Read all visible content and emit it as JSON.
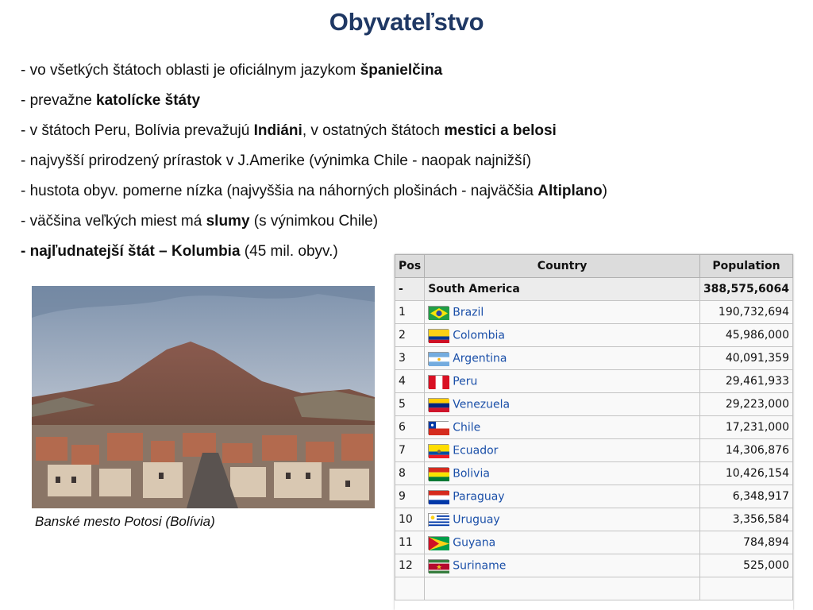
{
  "slide": {
    "title": "Obyvateľstvo",
    "bullets": [
      {
        "parts": [
          {
            "t": "-  vo všetkých štátoch oblasti je oficiálnym jazykom "
          },
          {
            "t": "španielčina",
            "b": true
          }
        ]
      },
      {
        "parts": [
          {
            "t": "-  prevažne "
          },
          {
            "t": "katolícke štáty",
            "b": true
          }
        ]
      },
      {
        "parts": [
          {
            "t": "-  v štátoch Peru, Bolívia prevažujú "
          },
          {
            "t": "Indiáni",
            "b": true
          },
          {
            "t": ", v ostatných štátoch "
          },
          {
            "t": "mestici a belosi",
            "b": true
          }
        ]
      },
      {
        "parts": [
          {
            "t": "-  najvyšší prirodzený prírastok v J.Amerike (výnimka Chile - naopak najnižší)"
          }
        ]
      },
      {
        "parts": [
          {
            "t": "-  hustota obyv. pomerne nízka (najvyššia  na náhorných plošinách - najväčšia "
          },
          {
            "t": "Altiplano",
            "b": true
          },
          {
            "t": ")"
          }
        ]
      },
      {
        "parts": [
          {
            "t": "-  väčšina veľkých miest má "
          },
          {
            "t": "slumy",
            "b": true
          },
          {
            "t": "  (s výnimkou Chile)"
          }
        ]
      },
      {
        "parts": [
          {
            "t": "-  najľudnatejší štát – Kolumbia",
            "b": true
          },
          {
            "t": " (45 mil. obyv.)"
          }
        ]
      }
    ],
    "caption": "Banské mesto Potosi (Bolívia)"
  },
  "table": {
    "headers": {
      "pos": "Pos",
      "country": "Country",
      "population": "Population"
    },
    "total": {
      "pos": "-",
      "country": "South America",
      "population": "388,575,6064"
    },
    "rows": [
      {
        "pos": "1",
        "country": "Brazil",
        "population": "190,732,694",
        "flag": "brazil"
      },
      {
        "pos": "2",
        "country": "Colombia",
        "population": "45,986,000",
        "flag": "colombia"
      },
      {
        "pos": "3",
        "country": "Argentina",
        "population": "40,091,359",
        "flag": "argentina"
      },
      {
        "pos": "4",
        "country": "Peru",
        "population": "29,461,933",
        "flag": "peru"
      },
      {
        "pos": "5",
        "country": "Venezuela",
        "population": "29,223,000",
        "flag": "venezuela"
      },
      {
        "pos": "6",
        "country": "Chile",
        "population": "17,231,000",
        "flag": "chile"
      },
      {
        "pos": "7",
        "country": "Ecuador",
        "population": "14,306,876",
        "flag": "ecuador"
      },
      {
        "pos": "8",
        "country": "Bolivia",
        "population": "10,426,154",
        "flag": "bolivia"
      },
      {
        "pos": "9",
        "country": "Paraguay",
        "population": "6,348,917",
        "flag": "paraguay"
      },
      {
        "pos": "10",
        "country": "Uruguay",
        "population": "3,356,584",
        "flag": "uruguay"
      },
      {
        "pos": "11",
        "country": "Guyana",
        "population": "784,894",
        "flag": "guyana"
      },
      {
        "pos": "12",
        "country": "Suriname",
        "population": "525,000",
        "flag": "suriname"
      },
      {
        "pos": "",
        "country": "",
        "population": "",
        "flag": ""
      }
    ]
  },
  "colors": {
    "title": "#1f3864",
    "link": "#1a4fa8"
  }
}
